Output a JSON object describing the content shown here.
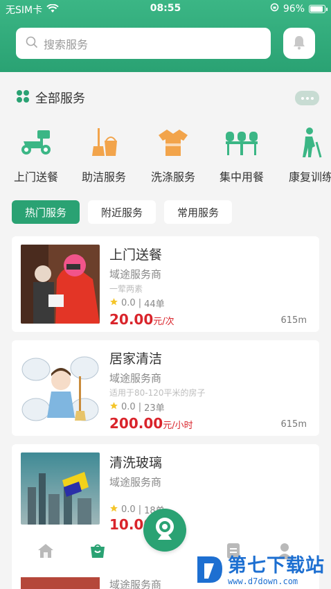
{
  "status_bar": {
    "carrier": "无SIM卡",
    "time": "08:55",
    "battery_text": "96%",
    "battery_level": 0.96
  },
  "search": {
    "placeholder": "搜索服务"
  },
  "all_services": {
    "title": "全部服务",
    "categories": [
      {
        "label": "上门送餐",
        "icon": "delivery-scooter-icon",
        "color": "#3bb685"
      },
      {
        "label": "助洁服务",
        "icon": "broom-bucket-icon",
        "color": "#f2a44b"
      },
      {
        "label": "洗涤服务",
        "icon": "shirt-icon",
        "color": "#f2a44b"
      },
      {
        "label": "集中用餐",
        "icon": "dining-table-icon",
        "color": "#3bb685"
      },
      {
        "label": "康复训练",
        "icon": "elderly-cane-icon",
        "color": "#3bb685"
      }
    ]
  },
  "tabs": [
    "热门服务",
    "附近服务",
    "常用服务"
  ],
  "services": [
    {
      "title": "上门送餐",
      "provider": "域途服务商",
      "desc": "一荤两素",
      "rating": "0.0",
      "orders": "44单",
      "price": "20.00",
      "unit": "元/次",
      "distance": "615m"
    },
    {
      "title": "居家清洁",
      "provider": "域途服务商",
      "desc": "适用于80-120平米的房子",
      "rating": "0.0",
      "orders": "23单",
      "price": "200.00",
      "unit": "元/小时",
      "distance": "615m"
    },
    {
      "title": "清洗玻璃",
      "provider": "域途服务商",
      "desc": "",
      "rating": "0.0",
      "orders": "18单",
      "price": "10.00",
      "unit": "",
      "distance": ""
    },
    {
      "title": "",
      "provider": "域途服务商"
    }
  ],
  "bottom_nav": {
    "items": [
      "home-icon",
      "shop-bag-icon",
      "camera-icon",
      "document-icon",
      "user-icon"
    ]
  },
  "watermark": {
    "big": "第七下载站",
    "small": "www.d7down.com"
  },
  "colors": {
    "primary": "#2aa273",
    "price": "#d9242b",
    "star": "#f4c52a",
    "watermark": "#1d6fd1"
  }
}
